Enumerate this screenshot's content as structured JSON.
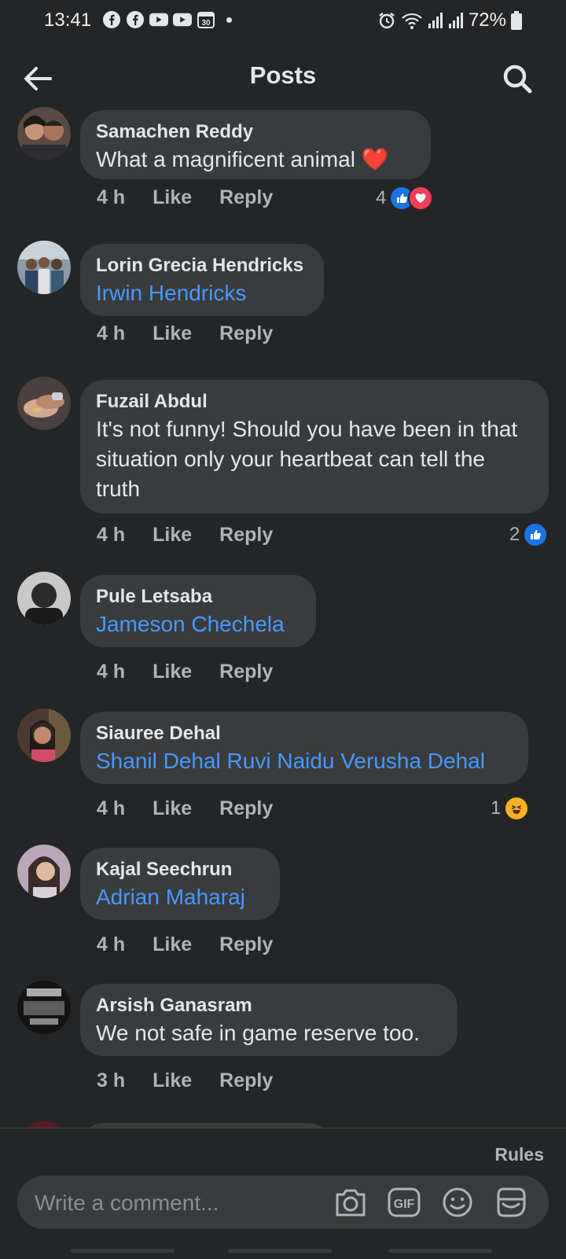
{
  "status_bar": {
    "time": "13:41",
    "battery": "72%",
    "calendar_day": "30",
    "left_icons": [
      "facebook-icon",
      "facebook-icon",
      "youtube-icon",
      "youtube-icon",
      "calendar-icon",
      "notification-dot"
    ],
    "right_icons": [
      "alarm-icon",
      "wifi-icon",
      "signal-icon",
      "signal-icon",
      "battery-icon"
    ]
  },
  "header": {
    "title": "Posts",
    "back_icon": "arrow-left-icon",
    "search_icon": "search-icon"
  },
  "comments": [
    {
      "author": "Samachen Reddy",
      "text": "What a magnificent animal",
      "text_emoji": "❤️",
      "time": "4 h",
      "like": "Like",
      "reply": "Reply",
      "reaction_count": "4",
      "reactions": [
        "like",
        "love"
      ]
    },
    {
      "author": "Lorin Grecia Hendricks",
      "text": "Irwin Hendricks",
      "is_tag": true,
      "time": "4 h",
      "like": "Like",
      "reply": "Reply"
    },
    {
      "author": "Fuzail Abdul",
      "text": "It's not funny! Should you have been in that situation only your heartbeat can tell the truth",
      "time": "4 h",
      "like": "Like",
      "reply": "Reply",
      "reaction_count": "2",
      "reactions": [
        "like"
      ]
    },
    {
      "author": "Pule Letsaba",
      "text": "Jameson Chechela",
      "is_tag": true,
      "time": "4 h",
      "like": "Like",
      "reply": "Reply"
    },
    {
      "author": "Siauree Dehal",
      "text": "Shanil Dehal Ruvi Naidu Verusha Dehal",
      "is_tag": true,
      "time": "4 h",
      "like": "Like",
      "reply": "Reply",
      "reaction_count": "1",
      "reactions": [
        "haha"
      ]
    },
    {
      "author": "Kajal Seechrun",
      "text": "Adrian Maharaj",
      "is_tag": true,
      "time": "4 h",
      "like": "Like",
      "reply": "Reply"
    },
    {
      "author": "Arsish Ganasram",
      "text": "We not safe in game reserve too.",
      "time": "3 h",
      "like": "Like",
      "reply": "Reply"
    }
  ],
  "composer": {
    "rules": "Rules",
    "placeholder": "Write a comment...",
    "icons": [
      "camera-icon",
      "gif-icon",
      "emoji-icon",
      "sticker-icon"
    ]
  },
  "colors": {
    "background": "#242526",
    "bubble": "#3a3b3c",
    "text": "#e4e6eb",
    "secondary_text": "#b0b3b8",
    "link": "#4599ff",
    "like_blue": "#1b74e4",
    "love_red": "#f33e58",
    "haha_yellow": "#f7b125"
  }
}
